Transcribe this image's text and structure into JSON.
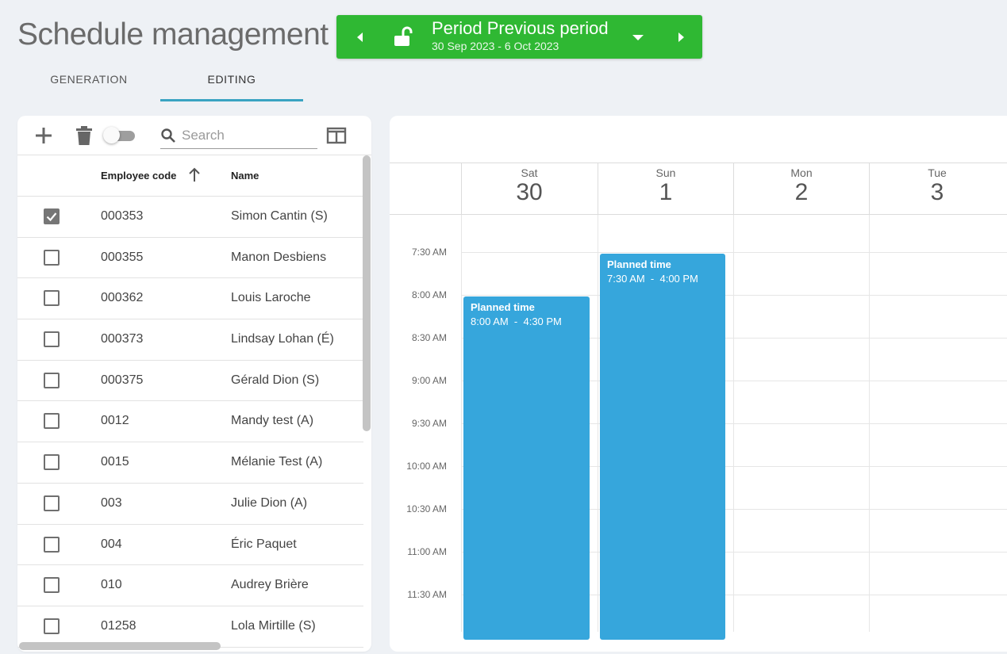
{
  "page": {
    "title": "Schedule management"
  },
  "period": {
    "label": "Period Previous period",
    "dates": "30 Sep 2023 - 6 Oct 2023",
    "color": "#2fb833"
  },
  "tabs": [
    {
      "label": "GENERATION",
      "active": false
    },
    {
      "label": "EDITING",
      "active": true
    }
  ],
  "toolbar": {
    "search_placeholder": "Search",
    "icons": [
      "plus-icon",
      "trash-icon",
      "toggle-switch",
      "search-icon",
      "columns-icon"
    ]
  },
  "table": {
    "columns": {
      "code": "Employee code",
      "name": "Name"
    },
    "sort": "ascending",
    "rows": [
      {
        "code": "000353",
        "name": "Simon Cantin (S)",
        "checked": true
      },
      {
        "code": "000355",
        "name": "Manon Desbiens",
        "checked": false
      },
      {
        "code": "000362",
        "name": "Louis Laroche",
        "checked": false
      },
      {
        "code": "000373",
        "name": "Lindsay Lohan (É)",
        "checked": false
      },
      {
        "code": "000375",
        "name": "Gérald Dion (S)",
        "checked": false
      },
      {
        "code": "0012",
        "name": "Mandy test (A)",
        "checked": false
      },
      {
        "code": "0015",
        "name": "Mélanie Test (A)",
        "checked": false
      },
      {
        "code": "003",
        "name": "Julie Dion (A)",
        "checked": false
      },
      {
        "code": "004",
        "name": "Éric Paquet",
        "checked": false
      },
      {
        "code": "010",
        "name": "Audrey Brière",
        "checked": false
      },
      {
        "code": "01258",
        "name": "Lola Mirtille (S)",
        "checked": false
      }
    ]
  },
  "calendar": {
    "days": [
      {
        "name": "Sat",
        "num": "30"
      },
      {
        "name": "Sun",
        "num": "1"
      },
      {
        "name": "Mon",
        "num": "2"
      },
      {
        "name": "Tue",
        "num": "3"
      }
    ],
    "times": [
      "7:30 AM",
      "8:00 AM",
      "8:30 AM",
      "9:00 AM",
      "9:30 AM",
      "10:00 AM",
      "10:30 AM",
      "11:00 AM",
      "11:30 AM"
    ],
    "events": [
      {
        "title": "Planned time",
        "hours": "8:00 AM  -  4:30 PM",
        "day": "Sat",
        "start": "8:00 AM",
        "end": "4:30 PM"
      },
      {
        "title": "Planned time",
        "hours": "7:30 AM  -  4:00 PM",
        "day": "Sun",
        "start": "7:30 AM",
        "end": "4:00 PM"
      }
    ],
    "event_color": "#36a6dc"
  }
}
